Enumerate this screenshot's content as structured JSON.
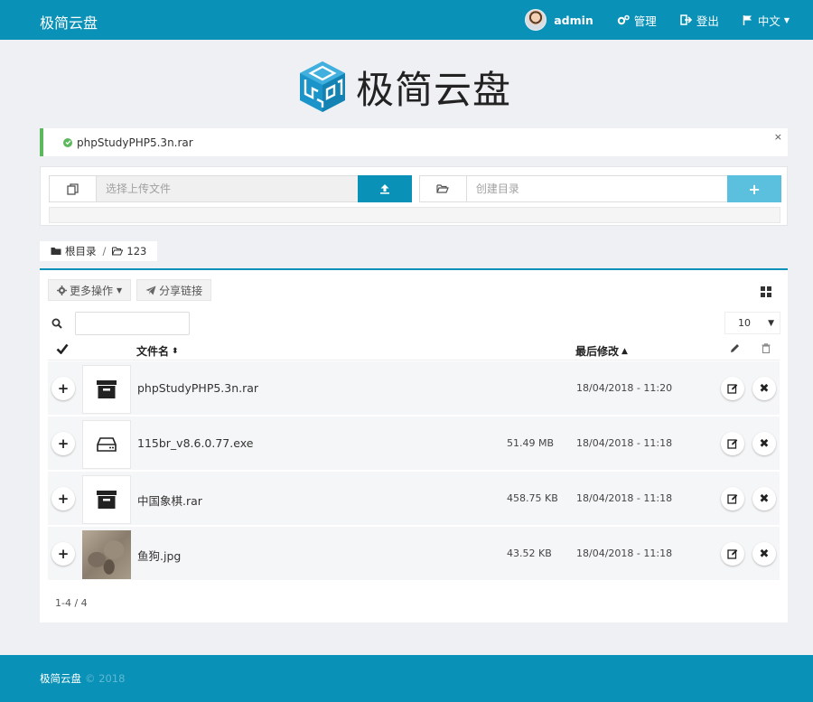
{
  "navbar": {
    "brand": "极简云盘",
    "user": "admin",
    "manage": "管理",
    "logout": "登出",
    "language": "中文"
  },
  "logo": {
    "text": "极简云盘"
  },
  "alert": {
    "message": "phpStudyPHP5.3n.rar",
    "close": "×"
  },
  "upload": {
    "file_placeholder": "选择上传文件",
    "dir_placeholder": "创建目录",
    "create_label": "+"
  },
  "breadcrumb": {
    "root": "根目录",
    "separator": "/",
    "current": "123"
  },
  "toolbar": {
    "more_label": "更多操作",
    "share_label": "分享链接"
  },
  "page_size": "10",
  "table": {
    "col_name": "文件名",
    "col_modified": "最后修改",
    "rows": [
      {
        "name": "phpStudyPHP5.3n.rar",
        "size": "",
        "date": "18/04/2018 - 11:20",
        "icon": "archive-icon"
      },
      {
        "name": "115br_v8.6.0.77.exe",
        "size": "51.49 MB",
        "date": "18/04/2018 - 11:18",
        "icon": "drive-icon"
      },
      {
        "name": "中国象棋.rar",
        "size": "458.75 KB",
        "date": "18/04/2018 - 11:18",
        "icon": "archive-icon"
      },
      {
        "name": "鱼狗.jpg",
        "size": "43.52 KB",
        "date": "18/04/2018 - 11:18",
        "icon": "image-thumbnail"
      }
    ]
  },
  "pager": "1-4 / 4",
  "footer": {
    "brand": "极简云盘",
    "copyright": "© 2018"
  },
  "colors": {
    "primary": "#0a91b7",
    "success": "#5cb85c",
    "info": "#5bc0de",
    "background": "#eef0f3"
  }
}
